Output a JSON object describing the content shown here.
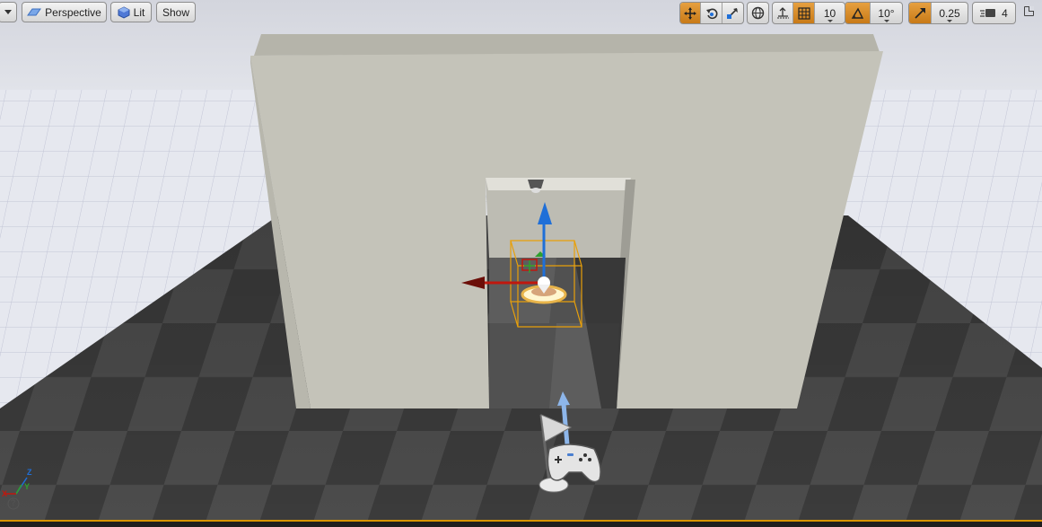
{
  "toolbar": {
    "view_mode": "Perspective",
    "lighting_mode": "Lit",
    "show_label": "Show",
    "grid_snap_value": "10",
    "rotation_snap_value": "10°",
    "scale_snap_value": "0.25",
    "camera_speed_value": "4",
    "active_transform_tool": "translate"
  },
  "axis_indicator": {
    "x": "X",
    "y": "Y",
    "z": "Z",
    "help": "?"
  },
  "colors": {
    "selection_orange": "#e8a00a",
    "active_tool": "#d68a22",
    "gizmo_x": "#c0180e",
    "gizmo_z": "#1f6fd8",
    "gizmo_y": "#2ea02e",
    "wall": "#c4c3b9",
    "sky": "#dcdee6"
  }
}
